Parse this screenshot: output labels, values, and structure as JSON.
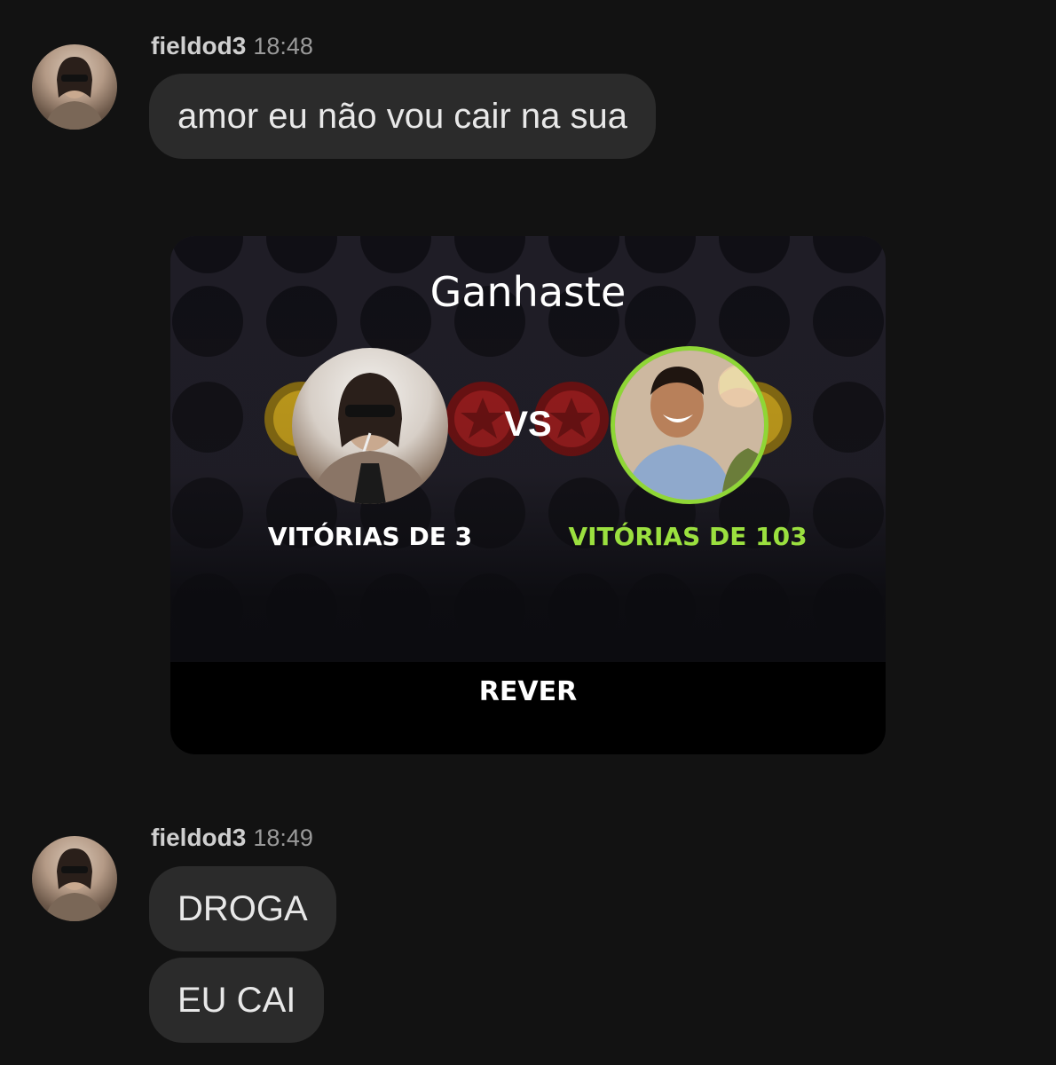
{
  "messages": [
    {
      "user": "fieldod3",
      "time": "18:48",
      "bubbles": [
        "amor eu não vou cair na sua"
      ]
    },
    {
      "user": "fieldod3",
      "time": "18:49",
      "bubbles": [
        "DROGA",
        "EU CAI"
      ]
    }
  ],
  "game_card": {
    "title": "Ganhaste",
    "vs_label": "VS",
    "left_player": {
      "wins_label": "VITÓRIAS DE 3"
    },
    "right_player": {
      "wins_label": "VITÓRIAS DE 103"
    },
    "action_label": "REVER"
  },
  "colors": {
    "background": "#121212",
    "bubble": "#2b2b2b",
    "winner_green": "#9be03f",
    "disc_red": "#9b1b1b",
    "disc_yellow": "#c9a21a"
  }
}
